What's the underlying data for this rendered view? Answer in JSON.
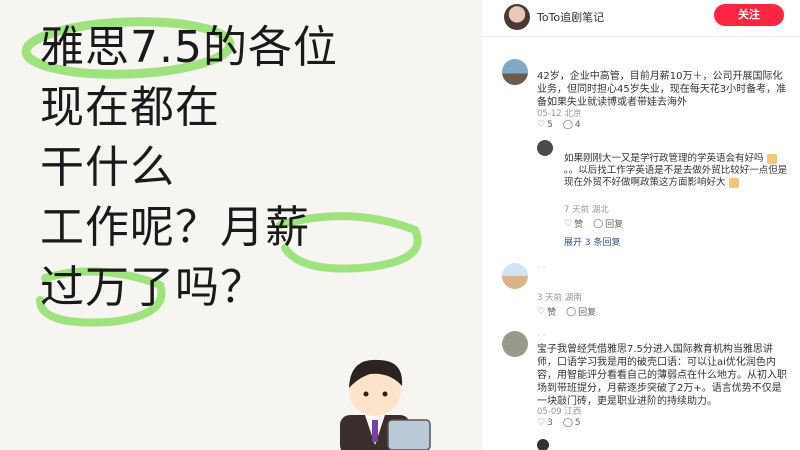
{
  "left_image": {
    "headline_lines": [
      "雅思7.5的各位",
      "现在都在",
      "干什么",
      "工作呢？月薪",
      "过万了吗？"
    ]
  },
  "header": {
    "author_name": "ToTo追剧笔记",
    "follow_label": "关注"
  },
  "comments": [
    {
      "text": "42岁，企业中高管，目前月薪10万＋，公司开展国际化业务，但同时担心45岁失业，现在每天花3小时备考，准备如果失业就读博或者带娃去海外",
      "date_loc": "05-12 北京",
      "likes": "5",
      "replies": "4"
    },
    {
      "text": "如果刚刚大一又是学行政管理的学英语会有好吗",
      "text2": "。。以后找工作学英语是不是去做外贸比较好一点但是现在外贸不好做啊政策这方面影响好大",
      "date_loc": "7 天前 湖北",
      "like_label": "赞",
      "reply_label": "回复",
      "expand_label": "展开 3 条回复"
    },
    {
      "text": "3 天前 湖南",
      "like_label": "赞",
      "reply_label": "回复"
    },
    {
      "text": "宝子我曾经凭借雅思7.5分进入国际教育机构当雅思讲师，口语学习我是用的破壳口语：可以让ai优化润色内容，用智能评分看看自己的薄弱点在什么地方。从初入职场到带班提分，月薪逐步突破了2万+。语言优势不仅是一块敲门砖，更是职业进阶的持续助力。",
      "date_loc": "05-09 江西",
      "likes": "3",
      "replies": "5"
    }
  ]
}
